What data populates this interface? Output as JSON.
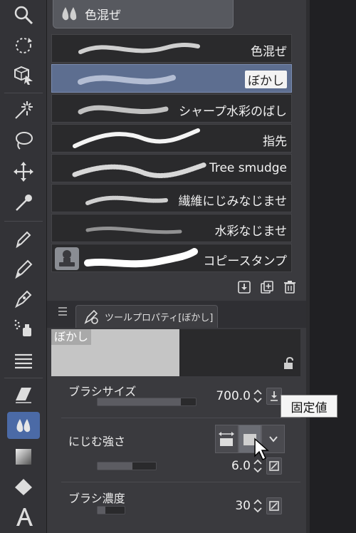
{
  "sub_tool_group": {
    "label": "色混ぜ",
    "icon": "water-drops-icon"
  },
  "brushes": [
    {
      "name": "色混ぜ",
      "selected": false
    },
    {
      "name": "ぼかし",
      "selected": true
    },
    {
      "name": "シャープ水彩のばし",
      "selected": false
    },
    {
      "name": "指先",
      "selected": false
    },
    {
      "name": "Tree smudge",
      "selected": false
    },
    {
      "name": "繊維にじみなじませ",
      "selected": false
    },
    {
      "name": "水彩なじませ",
      "selected": false
    },
    {
      "name": "コピースタンプ",
      "selected": false
    }
  ],
  "list_actions": [
    "import-icon",
    "duplicate-icon",
    "trash-icon"
  ],
  "tool_property": {
    "tab_label": "ツールプロパティ[ぼかし]",
    "preview_label": "ぼかし",
    "properties": [
      {
        "label": "ブラシサイズ",
        "value": "700.0",
        "fill": 0.85
      },
      {
        "label": "にじむ強さ",
        "value": "6.0",
        "fill": 0.6
      },
      {
        "label": "ブラシ濃度",
        "value": "30",
        "fill": 0.3
      }
    ],
    "tooltip": "固定値"
  },
  "toolbar": [
    "search-icon",
    "rotate-icon",
    "3d-cube-icon",
    "auto-select-icon",
    "lasso-icon",
    "move-icon",
    "eyedropper-icon",
    "pen-icon",
    "pencil-icon",
    "brush-icon",
    "spray-icon",
    "lines-icon",
    "eraser-icon",
    "blend-icon",
    "gradient-icon",
    "fill-icon",
    "text-icon"
  ],
  "colors": {
    "accent": "#4b6aa6",
    "selected_row": "#5d6e90",
    "panel": "#3a3a3e"
  }
}
